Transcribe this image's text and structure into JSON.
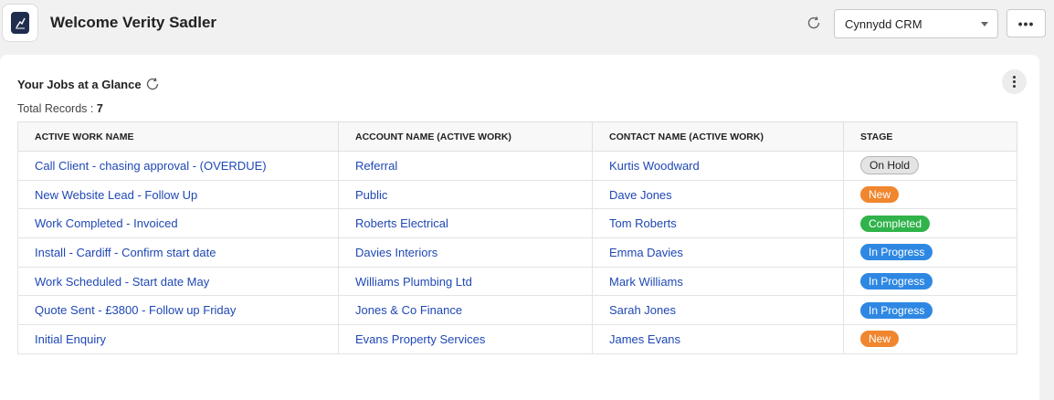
{
  "header": {
    "welcome": "Welcome Verity Sadler",
    "crm_selected": "Cynnydd CRM",
    "more_label": "•••"
  },
  "panel": {
    "title": "Your Jobs at a Glance",
    "total_label": "Total Records :",
    "total_value": "7"
  },
  "table": {
    "columns": [
      "ACTIVE WORK NAME",
      "ACCOUNT NAME (ACTIVE WORK)",
      "CONTACT NAME (ACTIVE WORK)",
      "STAGE"
    ],
    "rows": [
      {
        "work": "Call Client - chasing approval - (OVERDUE)",
        "account": "Referral",
        "contact": "Kurtis Woodward",
        "stage": "On Hold",
        "stage_color": "#e4e4e4"
      },
      {
        "work": "New Website Lead - Follow Up",
        "account": "Public",
        "contact": "Dave Jones",
        "stage": "New",
        "stage_color": "#f0862e"
      },
      {
        "work": "Work Completed - Invoiced",
        "account": "Roberts Electrical",
        "contact": "Tom Roberts",
        "stage": "Completed",
        "stage_color": "#2fb34a"
      },
      {
        "work": "Install - Cardiff - Confirm start date",
        "account": "Davies Interiors",
        "contact": "Emma Davies",
        "stage": "In Progress",
        "stage_color": "#2e88e3"
      },
      {
        "work": "Work Scheduled - Start date May",
        "account": "Williams Plumbing Ltd",
        "contact": "Mark Williams",
        "stage": "In Progress",
        "stage_color": "#2e88e3"
      },
      {
        "work": "Quote Sent - £3800 - Follow up Friday",
        "account": "Jones & Co Finance",
        "contact": "Sarah Jones",
        "stage": "In Progress",
        "stage_color": "#2e88e3"
      },
      {
        "work": "Initial Enquiry",
        "account": "Evans Property Services",
        "contact": "James Evans",
        "stage": "New",
        "stage_color": "#f0862e"
      }
    ]
  },
  "colors": {
    "link": "#1f48b4",
    "background": "#f1f1f1"
  },
  "icons": [
    "app-logo-icon",
    "refresh-icon",
    "chevron-down-icon",
    "more-horizontal-icon",
    "more-vertical-icon"
  ]
}
